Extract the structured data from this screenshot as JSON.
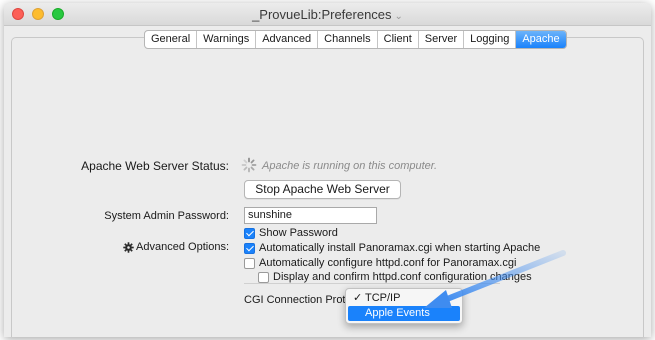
{
  "window": {
    "title": "_ProvueLib:Preferences"
  },
  "tabs": [
    "General",
    "Warnings",
    "Advanced",
    "Channels",
    "Client",
    "Server",
    "Logging",
    "Apache"
  ],
  "active_tab": "Apache",
  "status": {
    "label": "Apache Web Server Status:",
    "text": "Apache is running on this computer.",
    "stop_button": "Stop Apache Web Server"
  },
  "password": {
    "label": "System Admin Password:",
    "value": "sunshine"
  },
  "options": {
    "show_password": {
      "label": "Show Password",
      "checked": true
    },
    "advanced_label": "Advanced Options:",
    "auto_install": {
      "label": "Automatically install Panoramax.cgi when starting Apache",
      "checked": true
    },
    "auto_configure": {
      "label": "Automatically configure httpd.conf for Panoramax.cgi",
      "checked": false
    },
    "display_confirm": {
      "label": "Display and confirm httpd.conf configuration changes",
      "checked": false
    }
  },
  "cgi": {
    "label": "CGI Connection Protocol:",
    "options": [
      "TCP/IP",
      "Apple Events"
    ],
    "checked_option": "TCP/IP",
    "highlighted_option": "Apple Events"
  },
  "icons": {
    "title_chevron": "chevron-down-icon",
    "spinner": "spinner-icon",
    "gear": "gear-icon",
    "check": "checkmark-icon"
  },
  "colors": {
    "accent": "#1a82fb",
    "close": "#fc5f57",
    "minimize": "#fdbc2e",
    "zoom": "#28c840",
    "arrow": "#3f8cf0"
  }
}
